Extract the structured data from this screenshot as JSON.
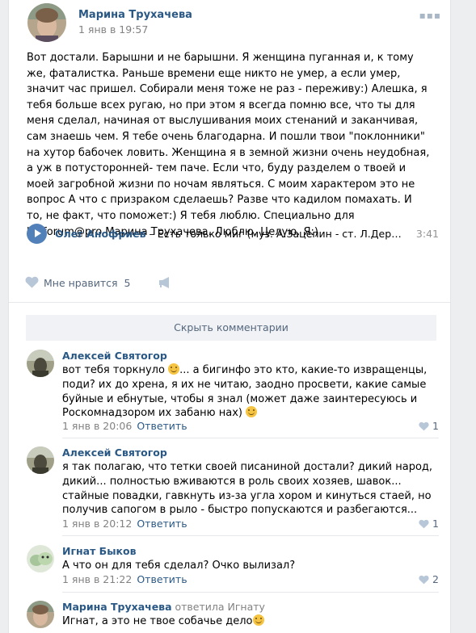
{
  "post": {
    "author": "Марина Трухачева",
    "date": "1 янв в 19:57",
    "text": "Вот достали. Барышни и не барышни. Я женщина пуганная и, к тому же, фаталистка. Раньше времени еще никто не умер, а если умер, значит час пришел. Собирали меня тоже не раз - переживу:) Алешка, я тебя больше всех ругаю, но при этом я всегда помню все, что ты для меня сделал, начиная от выслушивания моих стенаний и заканчивая, сам знаешь чем. Я тебе очень благодарна. И пошли твои \"поклонники\" на хутор бабочек ловить. Женщина я в земной жизни очень неудобная, а уж в потусторонней- тем паче. Если что, буду разделем о твоей и моей загробной жизни по ночам являться. С моим характером это не вопрос А что с призраком сделаешь? Разве что кадилом помахать. И то, не факт, что поможет:) Я тебя люблю. Специально для bigforum@pro Марина Трухачева. Люблю. Целую. Я:)",
    "audio": {
      "artist": "Олег Анофриев",
      "title": " – Есть только миг (муз. А.Зацепин - ст. Л.Дербенёв)",
      "duration": "3:41"
    },
    "likes_label": "Мне нравится",
    "likes_count": "5"
  },
  "hide_comments_label": "Скрыть комментарии",
  "comments": [
    {
      "author": "Алексей Святогор",
      "text_a": "вот тебя торкнуло ",
      "text_b": "... а бигинфо это кто, какие-то извращенцы, поди? их до хрена, я их не читаю, заодно просвети, какие самые буйные и ебнутые, чтобы я знал (может даже заинтересуюсь и Роскомнадзором их забаню нах) ",
      "date": "1 янв в 20:06",
      "reply_label": "Ответить",
      "likes": "1"
    },
    {
      "author": "Алексей Святогор",
      "text": "я так полагаю, что тетки своей писаниной достали? дикий народ, дикий... полностью вживаются в роль своих хозяев, шавок... стайные повадки, гавкнуть из-за угла хором и кинуться стаей, но получив сапогом в рыло - быстро попускаются и разбегаются...",
      "date": "1 янв в 20:12",
      "reply_label": "Ответить",
      "likes": "1"
    },
    {
      "author": "Игнат Быков",
      "text": "А что он для тебя сделал? Очко вылизал?",
      "date": "1 янв в 21:22",
      "reply_label": "Ответить",
      "likes": "2"
    },
    {
      "author": "Марина Трухачева",
      "reply_to": " ответила Игнату",
      "text": "Игнат, а это не твое собачье дело"
    }
  ],
  "colors": {
    "link": "#2a5885",
    "meta": "#828282",
    "accent": "#5181b8",
    "like": "#55677d"
  }
}
